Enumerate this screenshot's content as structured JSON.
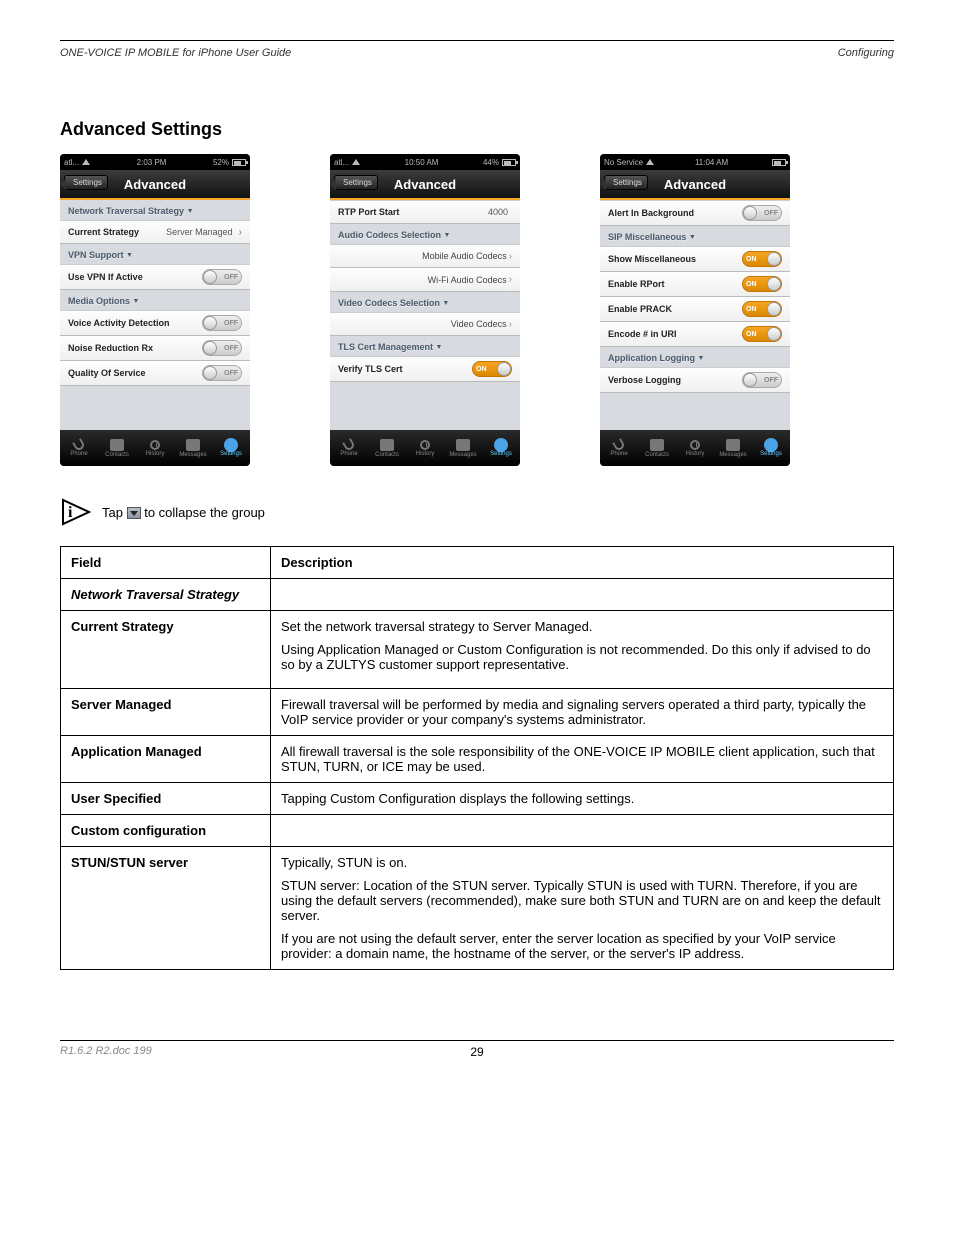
{
  "header": {
    "left": "ONE-VOICE IP MOBILE for iPhone User Guide",
    "right": "Configuring"
  },
  "section_title": "Advanced Settings",
  "screenshots": [
    {
      "status": {
        "carrier": "atl...",
        "time": "2:03 PM",
        "battery": "52%"
      },
      "nav": {
        "back": "Settings",
        "title": "Advanced"
      },
      "groups": [
        {
          "header": "Network Traversal Strategy",
          "rows": [
            {
              "label": "Current Strategy",
              "value": "Server Managed",
              "type": "disclosure"
            }
          ]
        },
        {
          "header": "VPN Support",
          "rows": [
            {
              "label": "Use VPN If Active",
              "type": "switch",
              "state": "off",
              "text": "OFF"
            }
          ]
        },
        {
          "header": "Media Options",
          "rows": [
            {
              "label": "Voice Activity Detection",
              "type": "switch",
              "state": "off",
              "text": "OFF"
            },
            {
              "label": "Noise Reduction Rx",
              "type": "switch",
              "state": "off",
              "text": "OFF"
            },
            {
              "label": "Quality Of Service",
              "type": "switch",
              "state": "off",
              "text": "OFF"
            }
          ]
        }
      ]
    },
    {
      "status": {
        "carrier": "atl...",
        "time": "10:50 AM",
        "battery": "44%"
      },
      "nav": {
        "back": "Settings",
        "title": "Advanced"
      },
      "groups": [
        {
          "header": "",
          "rows": [
            {
              "label": "RTP Port Start",
              "value": "4000",
              "type": "value"
            }
          ]
        },
        {
          "header": "Audio Codecs Selection",
          "rows": [
            {
              "label": "Mobile Audio Codecs",
              "type": "right-disclosure"
            },
            {
              "label": "Wi-Fi Audio Codecs",
              "type": "right-disclosure"
            }
          ]
        },
        {
          "header": "Video Codecs Selection",
          "rows": [
            {
              "label": "Video Codecs",
              "type": "right-disclosure"
            }
          ]
        },
        {
          "header": "TLS Cert Management",
          "rows": [
            {
              "label": "Verify TLS Cert",
              "type": "switch",
              "state": "on",
              "text": "ON"
            }
          ]
        }
      ]
    },
    {
      "status": {
        "carrier": "No Service",
        "time": "11:04 AM",
        "battery": ""
      },
      "nav": {
        "back": "Settings",
        "title": "Advanced"
      },
      "groups": [
        {
          "header": "",
          "rows": [
            {
              "label": "Alert In Background",
              "type": "switch",
              "state": "off",
              "text": "OFF"
            }
          ]
        },
        {
          "header": "SIP Miscellaneous",
          "rows": [
            {
              "label": "Show Miscellaneous",
              "type": "switch",
              "state": "on",
              "text": "ON"
            },
            {
              "label": "Enable RPort",
              "type": "switch",
              "state": "on",
              "text": "ON"
            },
            {
              "label": "Enable PRACK",
              "type": "switch",
              "state": "on",
              "text": "ON"
            },
            {
              "label": "Encode # in URI",
              "type": "switch",
              "state": "on",
              "text": "ON"
            }
          ]
        },
        {
          "header": "Application Logging",
          "rows": [
            {
              "label": "Verbose Logging",
              "type": "switch",
              "state": "off",
              "text": "OFF"
            }
          ]
        }
      ]
    }
  ],
  "tabs": [
    "Phone",
    "Contacts",
    "History",
    "Messages",
    "Settings"
  ],
  "info_text_before": "Tap ",
  "info_text_after": " to collapse the group",
  "table": {
    "headers": [
      "Field",
      "Description"
    ],
    "section1": "Network Traversal Strategy",
    "rows": [
      {
        "field": "Current Strategy",
        "desc": "Set the network traversal strategy to Server Managed._NL_Using Application Managed or Custom Configuration is not recommended. Do this only if advised to do so by a ZULTYS customer support representative._NL_"
      },
      {
        "field": "Server Managed",
        "desc": "Firewall traversal will be performed by media and signaling servers operated a third party, typically the VoIP service provider or your company's systems administrator."
      },
      {
        "field": "Application Managed",
        "desc": "All firewall traversal is the sole responsibility of the ONE-VOICE IP MOBILE client application, such that STUN, TURN, or ICE may be used."
      },
      {
        "field": "User Specified",
        "desc": "Tapping Custom Configuration displays the following settings."
      },
      {
        "field": "Custom configuration",
        "desc": ""
      },
      {
        "field": "STUN/STUN server",
        "desc": "Typically, STUN is on._NL_STUN server: Location of the STUN server. Typically STUN is used with TURN. Therefore, if you are using the default servers (recommended), make sure both STUN and TURN are on and keep the default server._NL_If you are not using the default server, enter the server location as specified by your VoIP service provider: a domain name, the hostname of the server, or the server's IP address."
      }
    ]
  },
  "footer": {
    "doc_id": "R1.6.2 R2.doc 199",
    "page": "29"
  }
}
